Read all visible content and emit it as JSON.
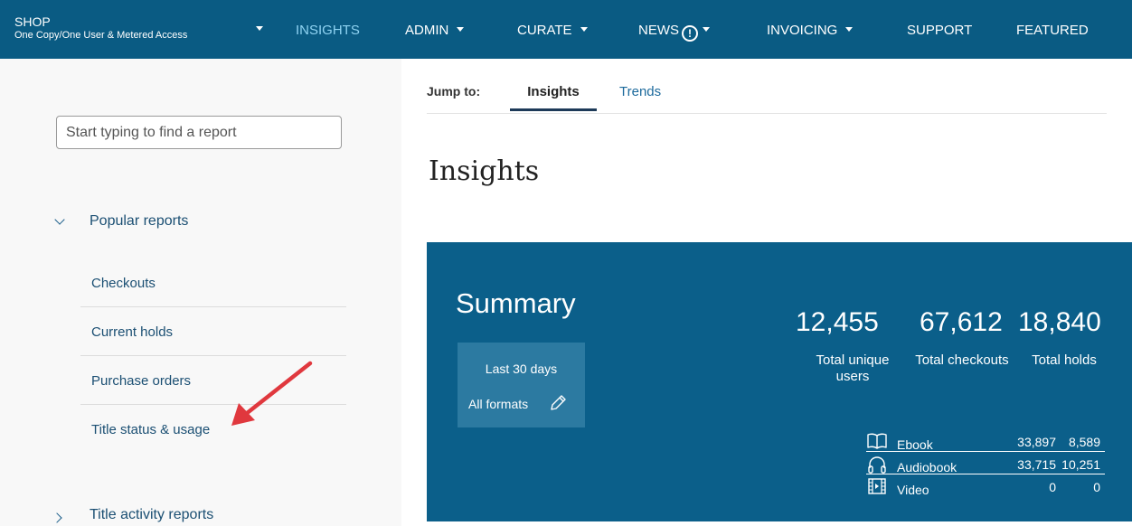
{
  "topnav": {
    "shop_title": "SHOP",
    "shop_subtitle": "One Copy/One User & Metered Access",
    "items": [
      {
        "label": "INSIGHTS",
        "active": true,
        "has_dropdown": false
      },
      {
        "label": "ADMIN",
        "has_dropdown": true
      },
      {
        "label": "CURATE",
        "has_dropdown": true
      },
      {
        "label": "NEWS",
        "has_dropdown": true,
        "icon": "alert-circle-icon"
      },
      {
        "label": "INVOICING",
        "has_dropdown": true
      },
      {
        "label": "SUPPORT",
        "has_dropdown": false
      },
      {
        "label": "FEATURED",
        "has_dropdown": false
      }
    ],
    "colors": {
      "background": "#0a5b83",
      "active": "#8fd3f2"
    }
  },
  "sidebar": {
    "search_placeholder": "Start typing to find a report",
    "sections": [
      {
        "title": "Popular reports",
        "expanded": true,
        "items": [
          "Checkouts",
          "Current holds",
          "Purchase orders",
          "Title status & usage"
        ]
      },
      {
        "title": "Title activity reports",
        "expanded": false
      }
    ]
  },
  "main": {
    "jump_label": "Jump to:",
    "tabs": [
      {
        "label": "Insights",
        "active": true
      },
      {
        "label": "Trends",
        "active": false
      }
    ],
    "title": "Insights",
    "summary": {
      "title": "Summary",
      "filter_range": "Last 30 days",
      "filter_formats": "All formats",
      "stats": [
        {
          "value": "12,455",
          "label": "Total unique users"
        },
        {
          "value": "67,612",
          "label": "Total checkouts"
        },
        {
          "value": "18,840",
          "label": "Total holds"
        }
      ],
      "formats": [
        {
          "name": "Ebook",
          "icon": "book-icon",
          "checkouts": "33,897",
          "holds": "8,589"
        },
        {
          "name": "Audiobook",
          "icon": "headphones-icon",
          "checkouts": "33,715",
          "holds": "10,251"
        },
        {
          "name": "Video",
          "icon": "film-icon",
          "checkouts": "0",
          "holds": "0"
        }
      ],
      "colors": {
        "card": "#0b5f8a",
        "filter_box": "#2c7aa1"
      }
    }
  }
}
